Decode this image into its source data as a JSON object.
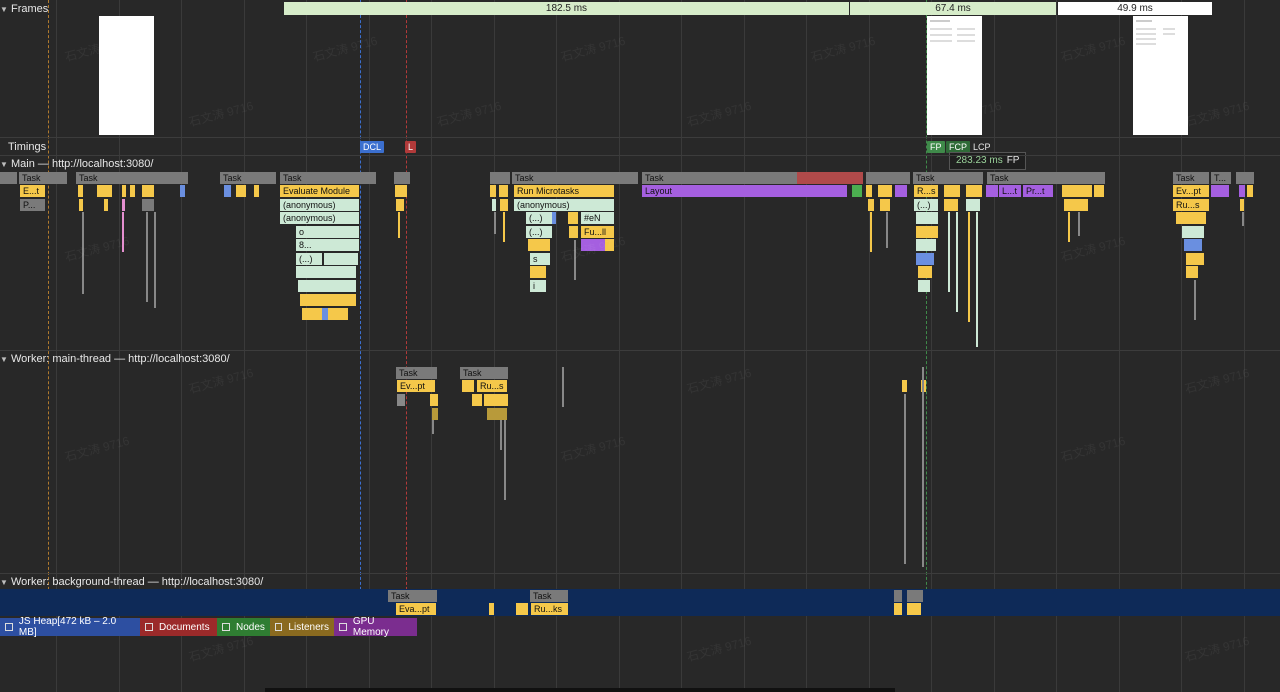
{
  "tracks": {
    "frames_label": "Frames",
    "timings_label": "Timings",
    "main_label": "Main — http://localhost:3080/",
    "worker_main_label": "Worker: main-thread — http://localhost:3080/",
    "worker_bg_label": "Worker: background-thread — http://localhost:3080/"
  },
  "frames": {
    "segments": [
      "182.5 ms",
      "67.4 ms",
      "49.9 ms"
    ]
  },
  "timings": {
    "dcl": "DCL",
    "l": "L",
    "fp": "FP",
    "fcp": "FCP",
    "lcp": "LCP"
  },
  "tooltip": {
    "time": "283.23 ms",
    "label": "FP"
  },
  "main_blocks": {
    "task": "Task",
    "task_short": "T...",
    "evaluate_module": "Evaluate Module",
    "anonymous": "(anonymous)",
    "o": "o",
    "eight": "8...",
    "paren": "(...)",
    "run_microtasks": "Run Microtasks",
    "hash_en": "#eN",
    "fu_ll": "Fu...ll",
    "s": "s",
    "i": "i",
    "layout": "Layout",
    "r_s": "R...s",
    "l_t": "L...t",
    "pr_t": "Pr...t",
    "ev_pt": "Ev...pt",
    "ru_s": "Ru...s",
    "e_t": "E...t",
    "p": "P..."
  },
  "worker_main_blocks": {
    "task": "Task",
    "ev_pt": "Ev...pt",
    "ru_s": "Ru...s"
  },
  "worker_bg_blocks": {
    "task": "Task",
    "eva_pt": "Eva...pt",
    "ru_ks": "Ru...ks"
  },
  "counters": [
    {
      "label": "JS Heap[472 kB – 2.0 MB]",
      "color": "#2d4fa1"
    },
    {
      "label": "Documents",
      "color": "#9b2a2a"
    },
    {
      "label": "Nodes",
      "color": "#2f7d32"
    },
    {
      "label": "Listeners",
      "color": "#8a6a1f"
    },
    {
      "label": "GPU Memory",
      "color": "#7b2d8f"
    }
  ],
  "watermark": "石文涛 9716",
  "colors": {
    "task": "#7a7a7a",
    "scripting": "#f5c84a",
    "rendering": "#a55fe0",
    "microtask": "#cde9d6",
    "frame_bar": "#d6ecc9",
    "dcl": "#3b6fcf",
    "l": "#b23a3a",
    "fp": "#3f8a4a",
    "bg_thread": "#0e2a58"
  }
}
